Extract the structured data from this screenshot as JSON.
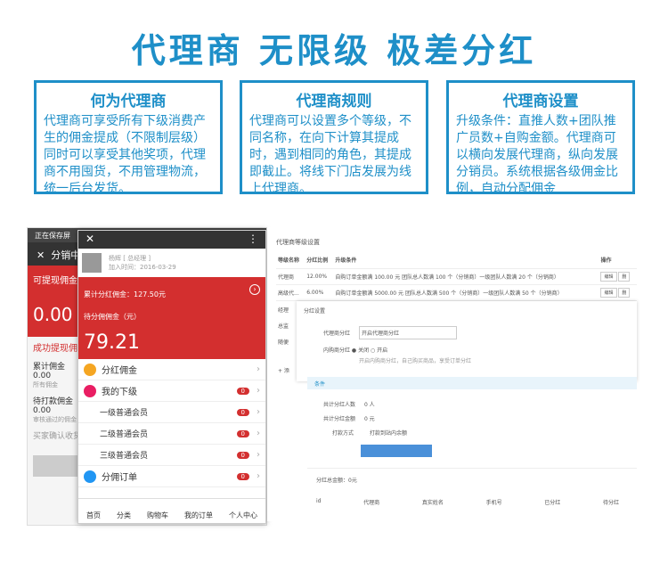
{
  "title": "代理商 无限级 极差分红",
  "boxes": [
    {
      "head": "何为代理商",
      "text": "代理商可享受所有下级消费产生的佣金提成（不限制层级）同时可以享受其他奖项，代理商不用囤货，不用管理物流，统一后台发货。"
    },
    {
      "head": "代理商规则",
      "text": "代理商可以设置多个等级，不同名称，在向下计算其提成时，遇到相同的角色，其提成即截止。将线下门店发展为线上代理商。"
    },
    {
      "head": "代理商设置",
      "text": "升级条件：直推人数+团队推广员数+自购金额。代理商可以横向发展代理商，纵向发展分销员。系统根据各级佣金比例，自动分配佣金"
    }
  ],
  "phone1": {
    "status": "正在保存屏",
    "header": "分销中",
    "withdraw": "可提现佣金（",
    "amount": "0.00",
    "link": "成功提现佣金（",
    "cum": "累计佣金",
    "cumv": "0.00",
    "cums": "所有佣金",
    "wait": "待打款佣金",
    "waitv": "0.00",
    "waits": "审核通过的佣金",
    "confirm": "买家确认收货后"
  },
  "phone2": {
    "close": "✕",
    "more": "⋮",
    "user": "杨辉 [ 总经理 ]",
    "time": "加入时间：2016-03-29",
    "total": "累计分红佣金：127.50元",
    "pending": "待分佣佣金（元）",
    "amount": "79.21",
    "rows": [
      {
        "label": "分红佣金",
        "color": "#f5a623"
      },
      {
        "label": "我的下级",
        "color": "#e91e63",
        "badge": "0"
      }
    ],
    "subs": [
      {
        "label": "一级普通会员",
        "badge": "0"
      },
      {
        "label": "二级普通会员",
        "badge": "0"
      },
      {
        "label": "三级普通会员",
        "badge": "0"
      }
    ],
    "orders": {
      "label": "分佣订单",
      "color": "#2196f3",
      "badge": "0"
    },
    "tabs": [
      "首页",
      "分类",
      "购物车",
      "我的订单",
      "个人中心"
    ]
  },
  "admin": {
    "title": "代理商等级设置",
    "cols": [
      "等级名称",
      "分红比例",
      "升级条件",
      "操作"
    ],
    "rows": [
      {
        "name": "代理商",
        "rate": "12.00%",
        "cond": "自购订单金额满 100.00 元 团队总人数满 100 个（分销商）一级团队人数满 20 个（分销商）",
        "edit": "编辑",
        "del": "删"
      },
      {
        "name": "高级代...",
        "rate": "6.00%",
        "cond": "自购订单金额满 5000.00 元 团队总人数满 500 个（分销商）一级团队人数满 50 个（分销商）",
        "edit": "编辑",
        "del": "删"
      }
    ],
    "side": [
      "经理",
      "总监",
      "随便"
    ],
    "modal": {
      "head": "分红设置",
      "l1": "代理商分红",
      "v1": "开启代理商分红",
      "l2": "内购商分红",
      "v2a": "关闭",
      "v2b": "开启",
      "hint": "开启内购商分红，自己购买商品，享受订单分红"
    },
    "cond": "条件",
    "c1": "共计分红人数",
    "c1v": "0 人",
    "c2": "共计分红金额",
    "c2v": "0 元",
    "c3": "打款方式",
    "c3v": "打款到站内余额",
    "foot": "分红总金额：0元",
    "fcols": [
      "id",
      "代理商",
      "真实姓名",
      "手机号",
      "已分红",
      "待分红"
    ],
    "add": "+ 添"
  }
}
